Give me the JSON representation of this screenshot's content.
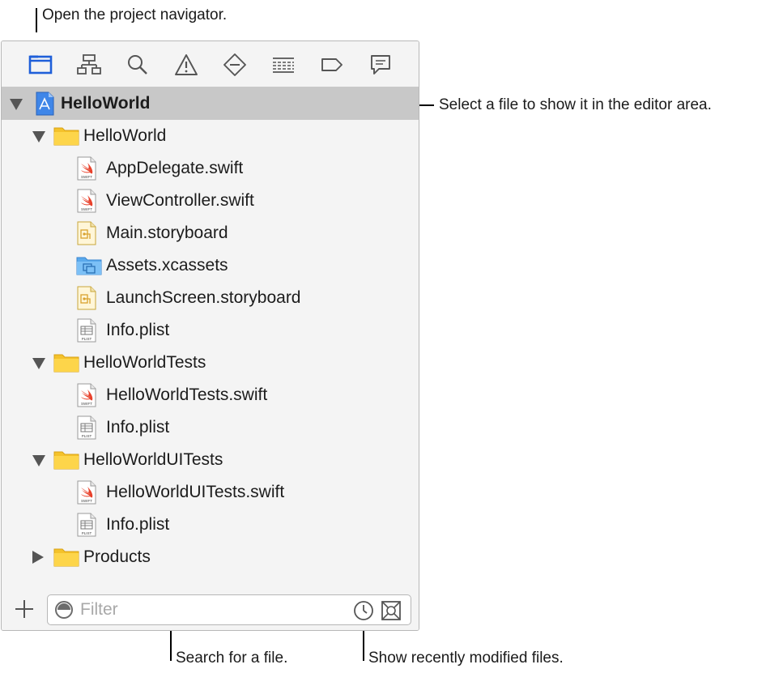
{
  "callouts": {
    "project_navigator": "Open the project navigator.",
    "select_file": "Select a file to show it in the editor area.",
    "search_file": "Search for a file.",
    "recent_files": "Show recently modified files."
  },
  "toolbar": {
    "icons": [
      "folder-icon",
      "hierarchy-icon",
      "search-icon",
      "warning-icon",
      "test-diamond-icon",
      "debug-list-icon",
      "breakpoint-tag-icon",
      "report-message-icon"
    ],
    "active_index": 0,
    "accent_color": "#1f5fd9"
  },
  "tree": [
    {
      "label": "HelloWorld",
      "type": "project",
      "level": 0,
      "expanded": true,
      "selected": true
    },
    {
      "label": "HelloWorld",
      "type": "folder",
      "level": 1,
      "expanded": true
    },
    {
      "label": "AppDelegate.swift",
      "type": "swift",
      "level": 2
    },
    {
      "label": "ViewController.swift",
      "type": "swift",
      "level": 2
    },
    {
      "label": "Main.storyboard",
      "type": "storyboard",
      "level": 2
    },
    {
      "label": "Assets.xcassets",
      "type": "assets",
      "level": 2
    },
    {
      "label": "LaunchScreen.storyboard",
      "type": "storyboard",
      "level": 2
    },
    {
      "label": "Info.plist",
      "type": "plist",
      "level": 2
    },
    {
      "label": "HelloWorldTests",
      "type": "folder",
      "level": 1,
      "expanded": true
    },
    {
      "label": "HelloWorldTests.swift",
      "type": "swift",
      "level": 2
    },
    {
      "label": "Info.plist",
      "type": "plist",
      "level": 2
    },
    {
      "label": "HelloWorldUITests",
      "type": "folder",
      "level": 1,
      "expanded": true
    },
    {
      "label": "HelloWorldUITests.swift",
      "type": "swift",
      "level": 2
    },
    {
      "label": "Info.plist",
      "type": "plist",
      "level": 2
    },
    {
      "label": "Products",
      "type": "folder",
      "level": 1,
      "expanded": false
    }
  ],
  "file_badges": {
    "swift": "SWIFT",
    "plist": "PLIST"
  },
  "filter": {
    "placeholder": "Filter",
    "value": ""
  }
}
